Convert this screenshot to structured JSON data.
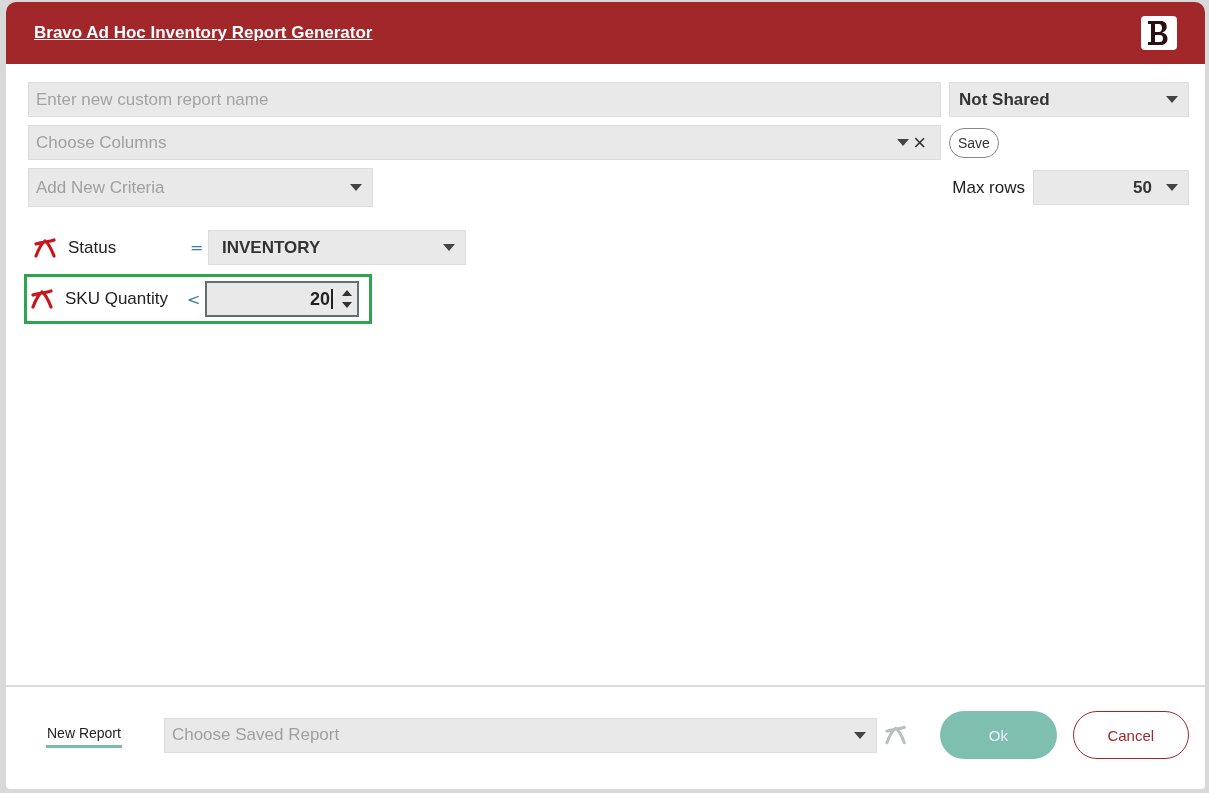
{
  "window": {
    "title": "Bravo Ad Hoc Inventory Report Generator"
  },
  "report_name": {
    "placeholder": "Enter new custom report name"
  },
  "sharing": {
    "value": "Not Shared"
  },
  "columns": {
    "placeholder": "Choose Columns",
    "clear": "×"
  },
  "save_button": "Save",
  "criteria_picker": {
    "placeholder": "Add New Criteria"
  },
  "max_rows": {
    "label": "Max rows",
    "value": "50"
  },
  "criteria": [
    {
      "kind": "select",
      "field": "Status",
      "operator": "=",
      "value": "INVENTORY",
      "highlighted": false
    },
    {
      "kind": "number",
      "field": "SKU Quantity",
      "operator": "<",
      "value": "20",
      "highlighted": true
    }
  ],
  "footer": {
    "new_report": "New Report",
    "saved_report": {
      "placeholder": "Choose Saved Report"
    },
    "ok": {
      "label": "Ok",
      "disabled": true
    },
    "cancel": "Cancel"
  }
}
